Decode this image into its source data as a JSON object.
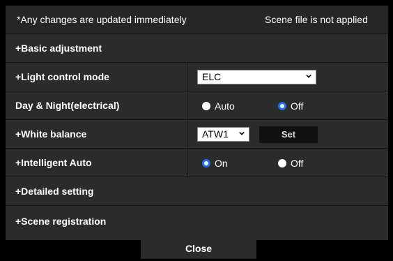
{
  "notice": {
    "left": "*Any changes are updated immediately",
    "right": "Scene file is not applied"
  },
  "rows": {
    "basic_adjustment": "+Basic adjustment",
    "light_control_mode": {
      "label": "+Light control mode",
      "value": "ELC"
    },
    "day_night": {
      "label": "Day & Night(electrical)",
      "options": [
        "Auto",
        "Off"
      ],
      "selected": "Off"
    },
    "white_balance": {
      "label": "+White balance",
      "value": "ATW1",
      "set_label": "Set"
    },
    "intelligent_auto": {
      "label": "+Intelligent Auto",
      "options": [
        "On",
        "Off"
      ],
      "selected": "On"
    },
    "detailed_setting": "+Detailed setting",
    "scene_registration": "+Scene registration"
  },
  "close_label": "Close",
  "colors": {
    "accent": "#1a73e8",
    "row_bg": "#2b2b2b",
    "page_bg": "#000000"
  }
}
